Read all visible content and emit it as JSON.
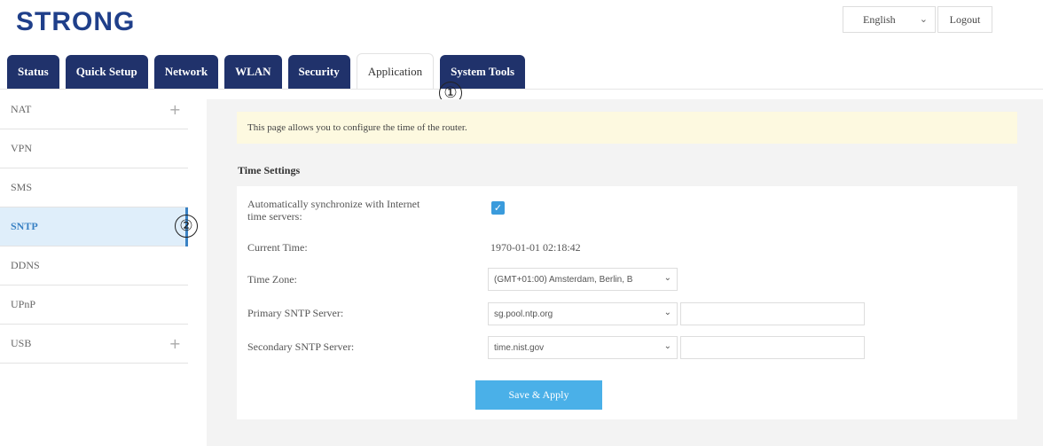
{
  "header": {
    "logo_text": "STRONG",
    "language": "English",
    "logout_label": "Logout"
  },
  "tabs": [
    {
      "label": "Status"
    },
    {
      "label": "Quick Setup"
    },
    {
      "label": "Network"
    },
    {
      "label": "WLAN"
    },
    {
      "label": "Security"
    },
    {
      "label": "Application",
      "active": true
    },
    {
      "label": "System Tools"
    }
  ],
  "markers": {
    "one": "①",
    "two": "②"
  },
  "sidebar": {
    "items": [
      {
        "label": "NAT",
        "expandable": true
      },
      {
        "label": "VPN"
      },
      {
        "label": "SMS"
      },
      {
        "label": "SNTP",
        "active": true
      },
      {
        "label": "DDNS"
      },
      {
        "label": "UPnP"
      },
      {
        "label": "USB",
        "expandable": true
      }
    ],
    "plus_symbol": "+"
  },
  "main": {
    "note": "This page allows you to configure the time of the router.",
    "section_title": "Time Settings",
    "auto_sync_label": "Automatically synchronize with Internet time servers:",
    "auto_sync_checked": true,
    "current_time_label": "Current Time:",
    "current_time_value": "1970-01-01 02:18:42",
    "time_zone_label": "Time Zone:",
    "time_zone_value": "(GMT+01:00) Amsterdam, Berlin, B",
    "primary_label": "Primary SNTP Server:",
    "primary_value": "sg.pool.ntp.org",
    "secondary_label": "Secondary SNTP Server:",
    "secondary_value": "time.nist.gov",
    "save_label": "Save & Apply"
  },
  "colors": {
    "tab_bg": "#20326b",
    "accent": "#3a82c4",
    "save_button": "#4ab0e8",
    "note_bg": "#fdf9e0"
  }
}
